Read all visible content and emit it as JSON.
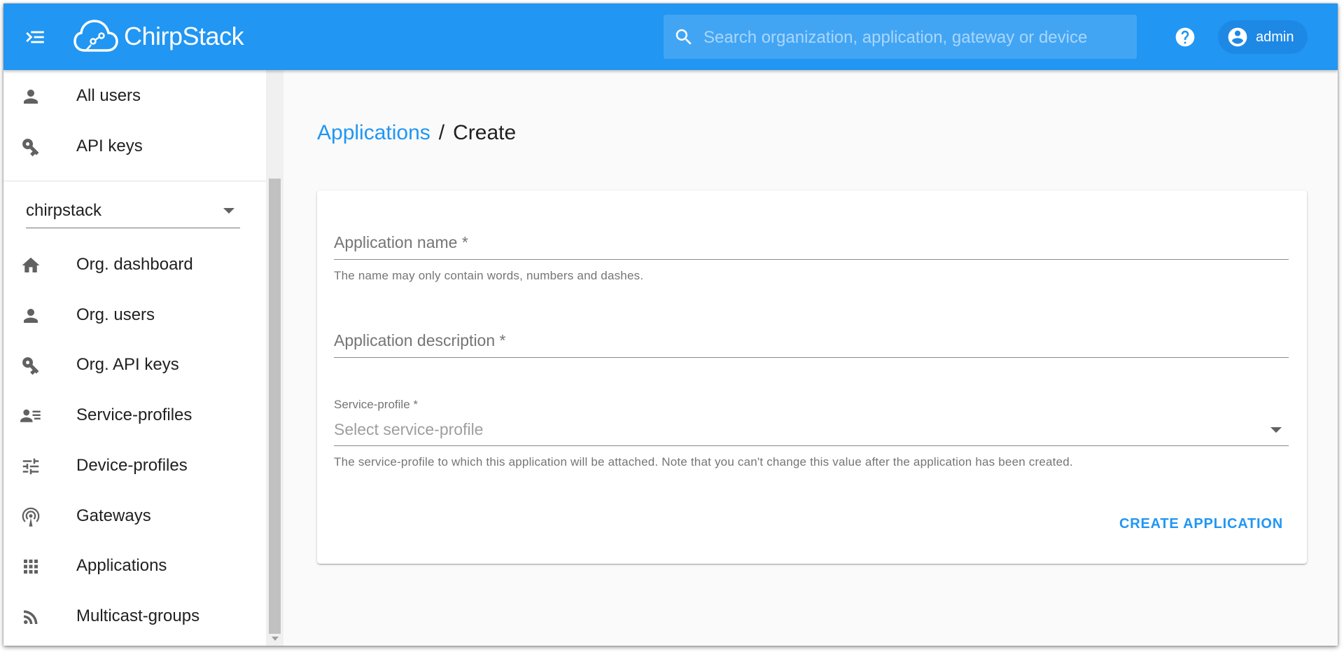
{
  "header": {
    "brand": "ChirpStack",
    "search_placeholder": "Search organization, application, gateway or device",
    "user": "admin"
  },
  "sidebar": {
    "top_items": [
      {
        "label": "All users",
        "icon": "person-icon"
      },
      {
        "label": "API keys",
        "icon": "key-icon"
      }
    ],
    "organization": "chirpstack",
    "org_items": [
      {
        "label": "Org. dashboard",
        "icon": "home-icon"
      },
      {
        "label": "Org. users",
        "icon": "person-icon"
      },
      {
        "label": "Org. API keys",
        "icon": "key-icon"
      },
      {
        "label": "Service-profiles",
        "icon": "account-details-icon"
      },
      {
        "label": "Device-profiles",
        "icon": "tune-icon"
      },
      {
        "label": "Gateways",
        "icon": "access-point-icon"
      },
      {
        "label": "Applications",
        "icon": "apps-icon"
      },
      {
        "label": "Multicast-groups",
        "icon": "rss-icon"
      }
    ]
  },
  "breadcrumb": {
    "parent": "Applications",
    "separator": "/",
    "current": "Create"
  },
  "form": {
    "name": {
      "value": "",
      "placeholder": "Application name *",
      "helper": "The name may only contain words, numbers and dashes."
    },
    "description": {
      "value": "",
      "placeholder": "Application description *"
    },
    "service_profile": {
      "label": "Service-profile *",
      "placeholder": "Select service-profile",
      "helper": "The service-profile to which this application will be attached. Note that you can't change this value after the application has been created."
    },
    "submit_label": "CREATE APPLICATION"
  },
  "colors": {
    "primary": "#2196f3",
    "text": "#212121",
    "muted": "#757575"
  }
}
